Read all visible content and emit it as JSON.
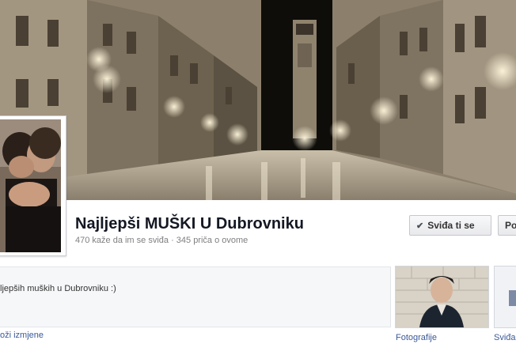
{
  "page": {
    "title": "Najljepši MUŠKI U Dubrovniku",
    "stats": "470 kaže da im se sviđa · 345 priča o ovome"
  },
  "actions": {
    "like_label": "Sviđa ti se",
    "like_icon": "check-icon",
    "other_label": "Po"
  },
  "about": {
    "text": "ljepših muških u Dubrovniku :)",
    "edit_link": "oži izmjene"
  },
  "apps": {
    "photos_label": "Fotografije",
    "likes_label": "Sviđa"
  },
  "colors": {
    "link": "#3b5998",
    "title": "#141823",
    "muted": "#7f7f7f"
  }
}
